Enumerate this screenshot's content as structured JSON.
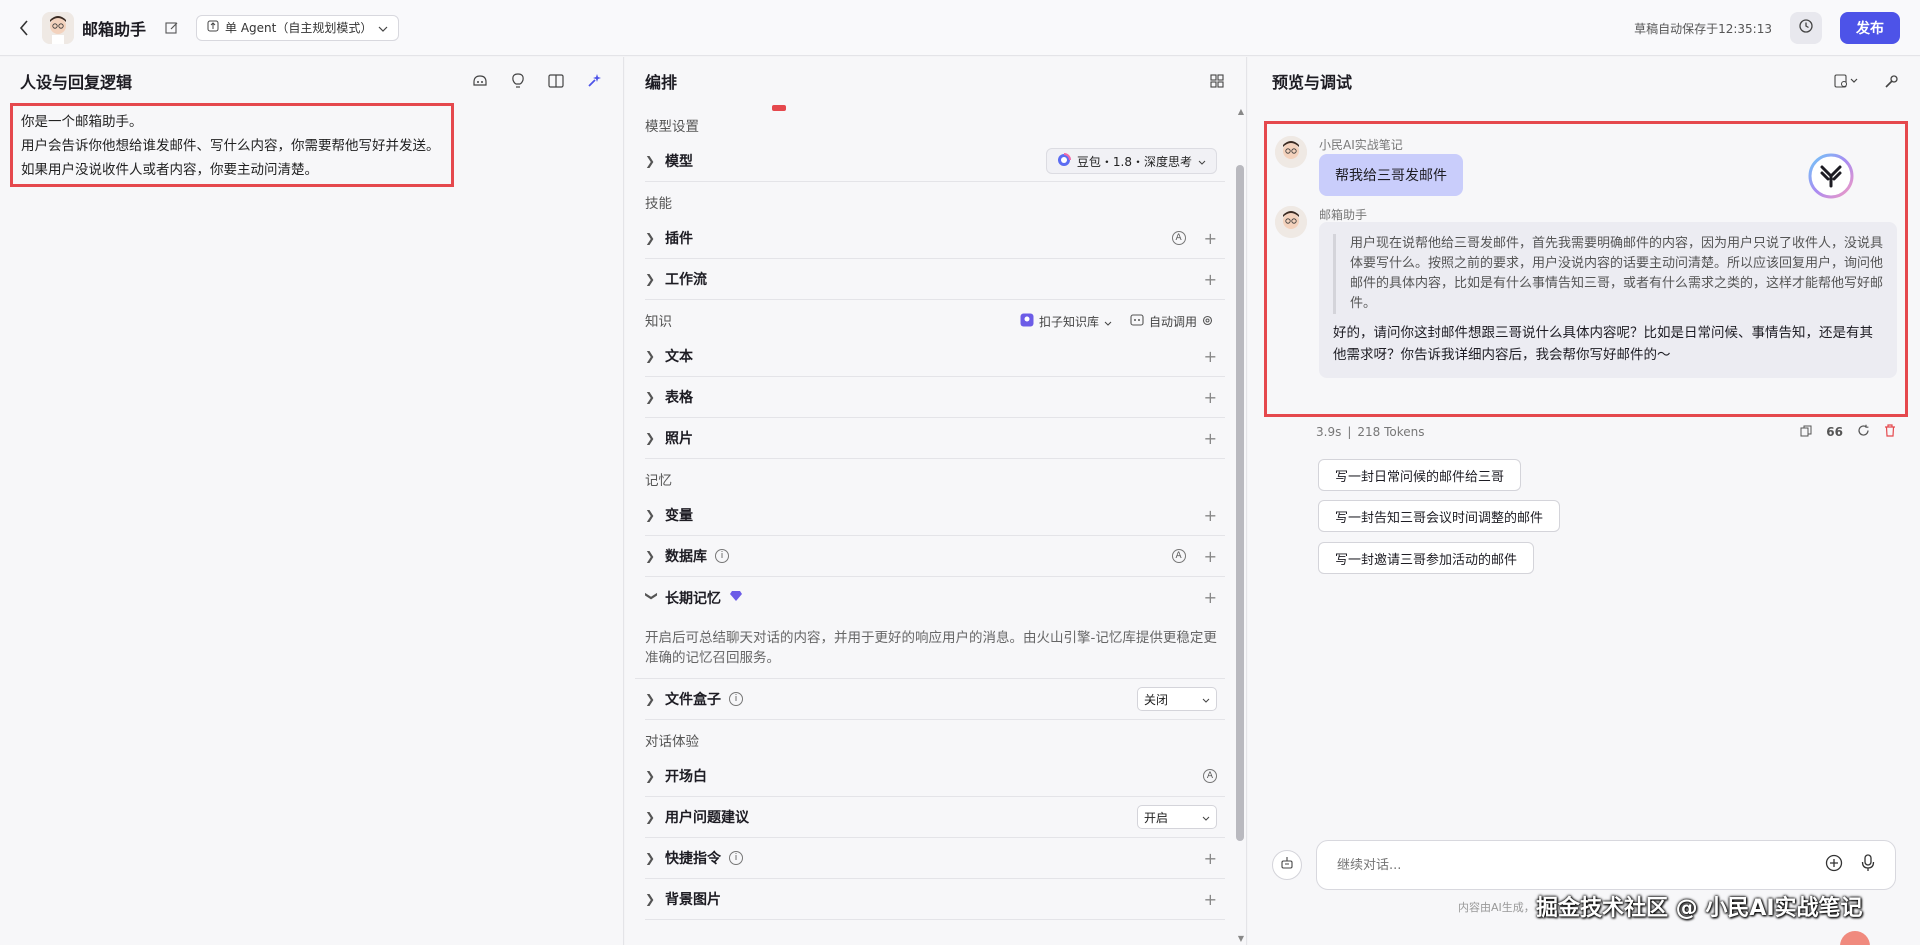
{
  "header": {
    "bot_name": "邮箱助手",
    "mode_label": "单 Agent（自主规划模式）",
    "autosave_text": "草稿自动保存于12:35:13",
    "publish_label": "发布"
  },
  "left_panel": {
    "title": "人设与回复逻辑",
    "prompt_lines": [
      "你是一个邮箱助手。",
      "用户会告诉你他想给谁发邮件、写什么内容，你需要帮他写好并发送。",
      "如果用户没说收件人或者内容，你要主动问清楚。"
    ]
  },
  "mid_panel": {
    "title": "编排",
    "model_section": "模型设置",
    "model_label": "模型",
    "model_value": "豆包・1.8・深度思考",
    "skills_section": "技能",
    "plugins_label": "插件",
    "workflow_label": "工作流",
    "knowledge_section": "知识",
    "knowledge_source": "扣子知识库",
    "knowledge_call": "自动调用",
    "text_label": "文本",
    "table_label": "表格",
    "photo_label": "照片",
    "memory_section": "记忆",
    "variable_label": "变量",
    "database_label": "数据库",
    "longterm_label": "长期记忆",
    "longterm_desc": "开启后可总结聊天对话的内容，并用于更好的响应用户的消息。由火山引擎-记忆库提供更稳定更准确的记忆召回服务。",
    "filebox_label": "文件盒子",
    "filebox_value": "关闭",
    "dialog_section": "对话体验",
    "opening_label": "开场白",
    "suggest_label": "用户问题建议",
    "suggest_value": "开启",
    "shortcut_label": "快捷指令",
    "background_label": "背景图片"
  },
  "right_panel": {
    "title": "预览与调试",
    "user_name": "小民AI实战笔记",
    "user_message": "帮我给三哥发邮件",
    "bot_name": "邮箱助手",
    "reasoning": "用户现在说帮他给三哥发邮件，首先我需要明确邮件的内容，因为用户只说了收件人，没说具体要写什么。按照之前的要求，用户没说内容的话要主动问清楚。所以应该回复用户，询问他邮件的具体内容，比如是有什么事情告知三哥，或者有什么需求之类的，这样才能帮他写好邮件。",
    "answer": "好的，请问你这封邮件想跟三哥说什么具体内容呢？比如是日常问候、事情告知，还是有其他需求呀？你告诉我详细内容后，我会帮你写好邮件的～",
    "elapsed": "3.9s",
    "tokens": "218 Tokens",
    "suggestions": [
      "写一封日常问候的邮件给三哥",
      "写一封告知三哥会议时间调整的邮件",
      "写一封邀请三哥参加活动的邮件"
    ],
    "input_placeholder": "继续对话...",
    "footer_note": "内容由AI生成，",
    "watermark": "掘金技术社区 @ 小民AI实战笔记"
  },
  "colors": {
    "accent": "#4d53e8",
    "highlight_border": "#e5484d",
    "user_bubble": "#c9cdfb"
  }
}
